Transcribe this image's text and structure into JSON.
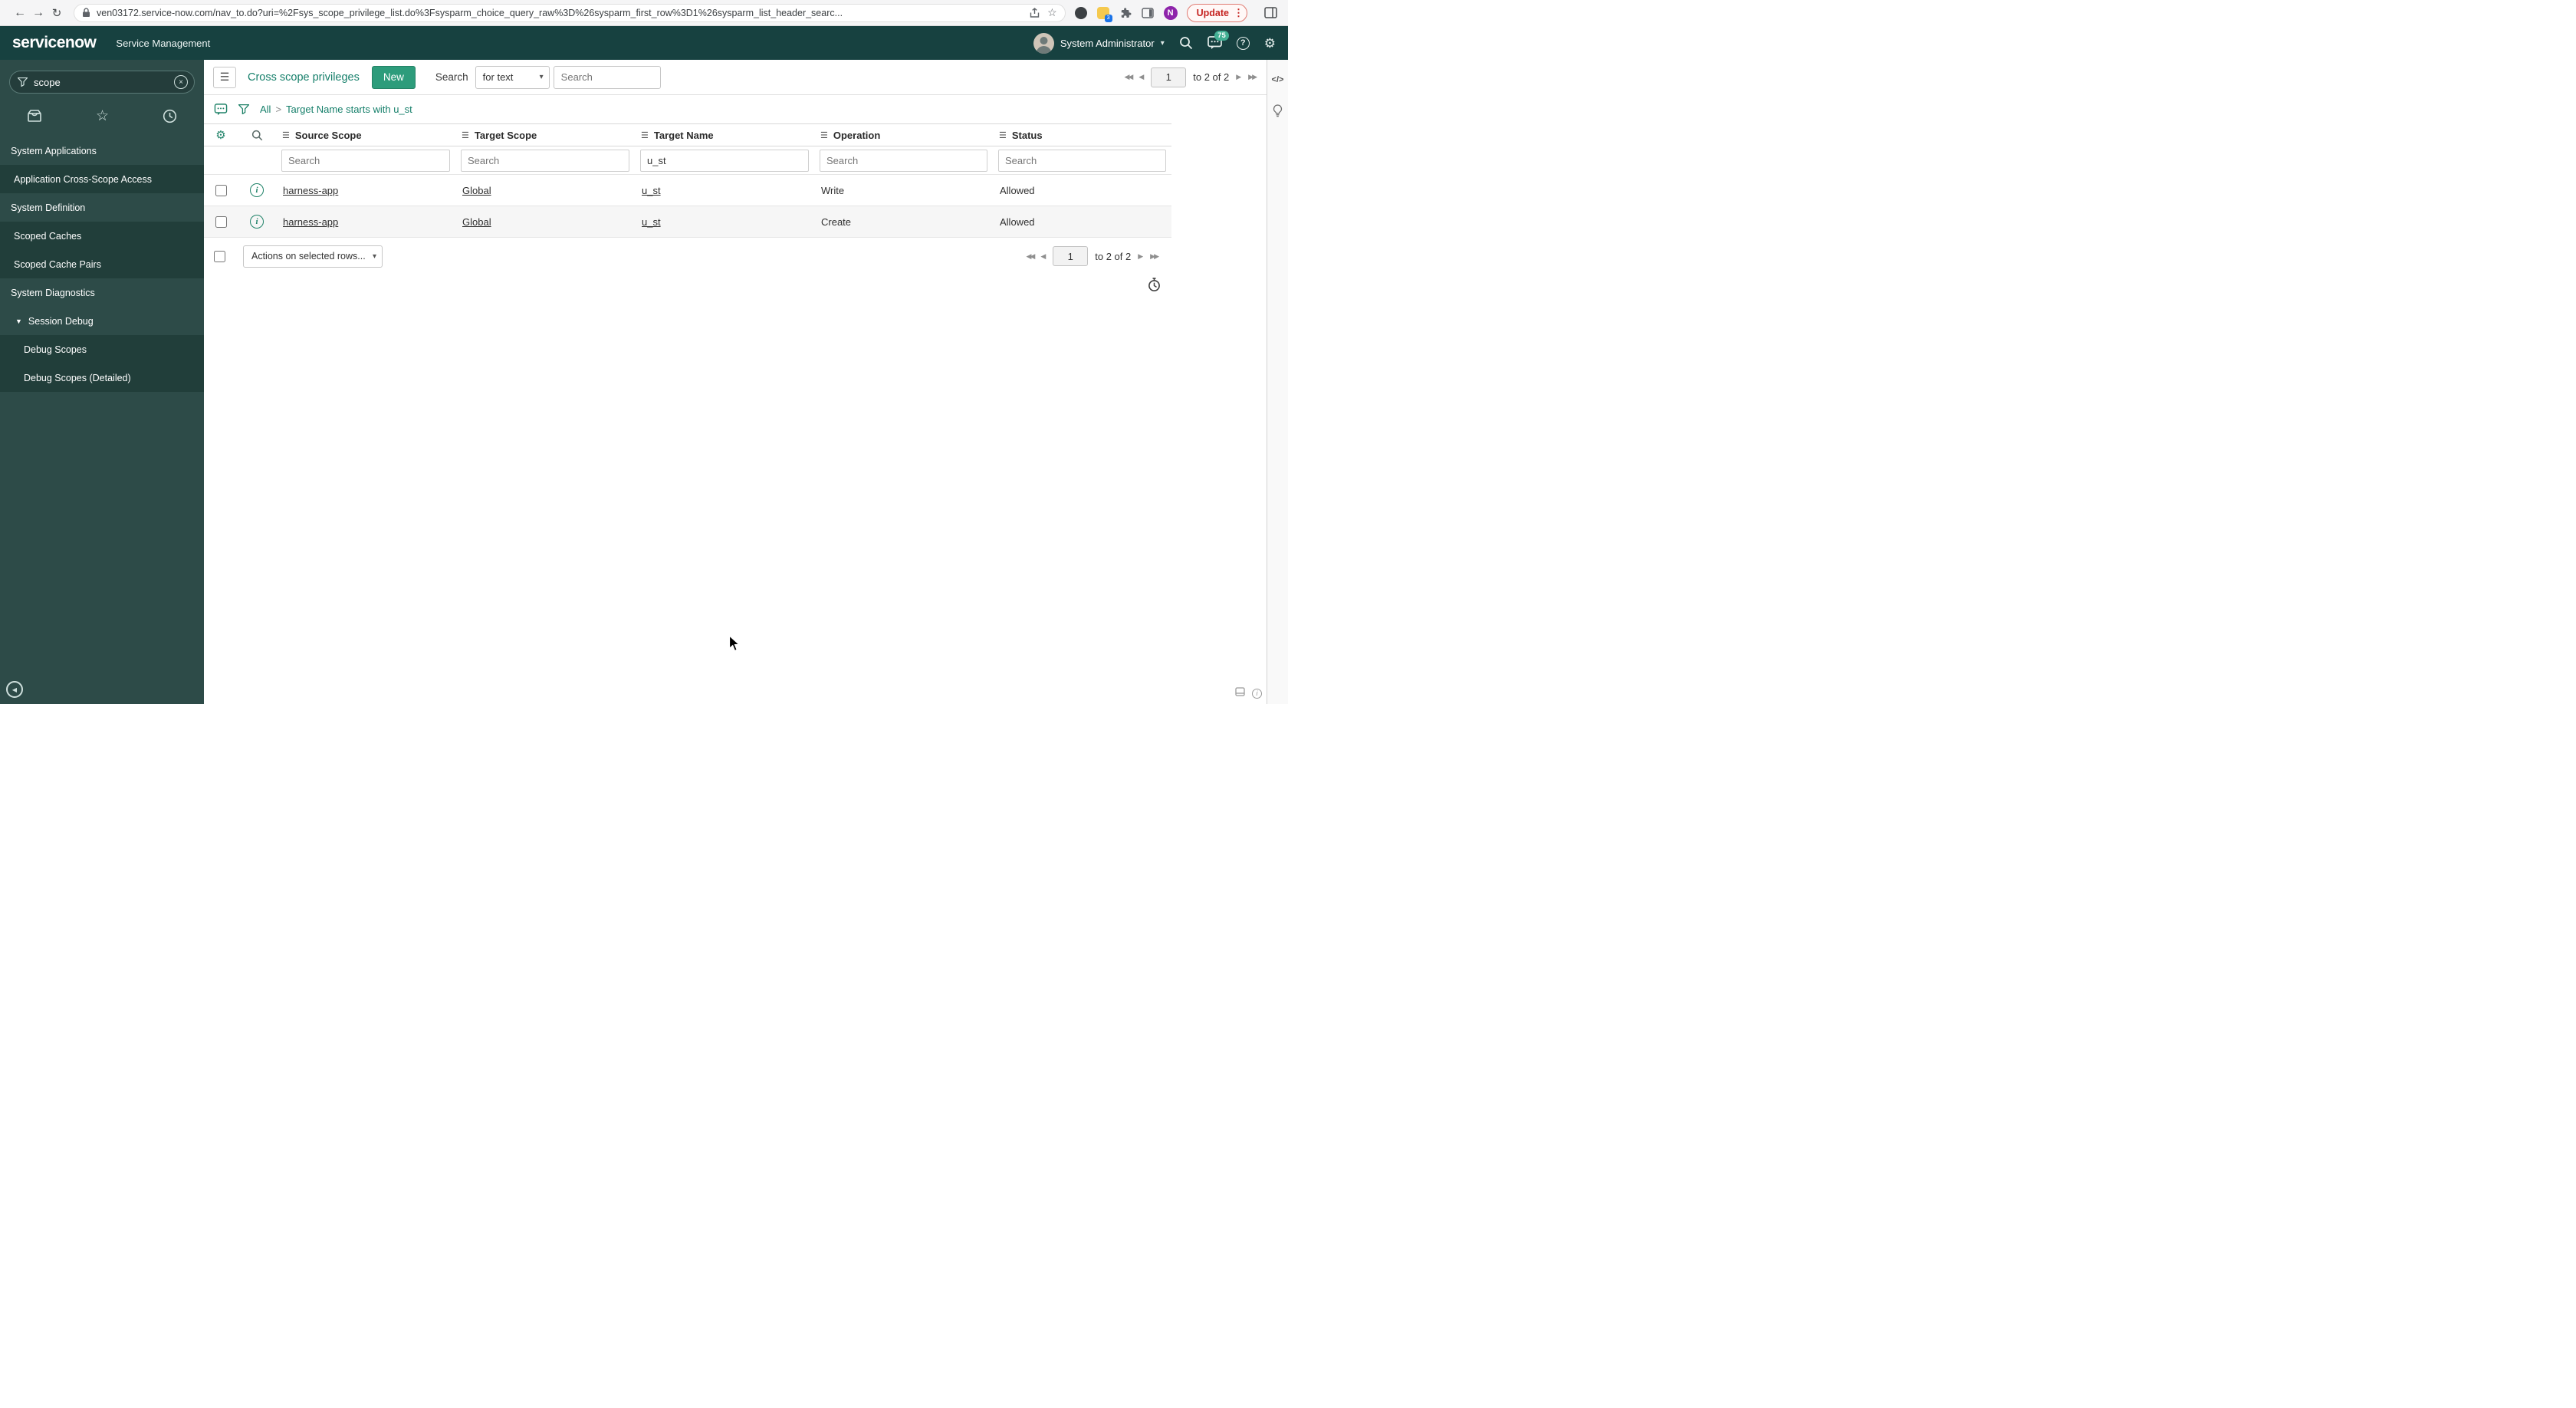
{
  "browser": {
    "url": "ven03172.service-now.com/nav_to.do?uri=%2Fsys_scope_privilege_list.do%3Fsysparm_choice_query_raw%3D%26sysparm_first_row%3D1%26sysparm_list_header_searc...",
    "update_label": "Update",
    "extension_badge": "3",
    "profile_initial": "N"
  },
  "banner": {
    "logo": "servicenow",
    "product": "Service Management",
    "user": "System Administrator",
    "notification_count": "75"
  },
  "sidebar": {
    "filter_value": "scope",
    "items": [
      {
        "label": "System Applications",
        "type": "section"
      },
      {
        "label": "Application Cross-Scope Access",
        "type": "child"
      },
      {
        "label": "System Definition",
        "type": "section"
      },
      {
        "label": "Scoped Caches",
        "type": "child"
      },
      {
        "label": "Scoped Cache Pairs",
        "type": "child"
      },
      {
        "label": "System Diagnostics",
        "type": "section"
      },
      {
        "label": "Session Debug",
        "type": "expanded"
      },
      {
        "label": "Debug Scopes",
        "type": "subchild"
      },
      {
        "label": "Debug Scopes (Detailed)",
        "type": "subchild"
      }
    ]
  },
  "list": {
    "title": "Cross scope privileges",
    "new_label": "New",
    "search_label": "Search",
    "search_type": "for text",
    "search_placeholder": "Search",
    "breadcrumb": {
      "all": "All",
      "sep": ">",
      "query": "Target Name starts with u_st"
    },
    "pagination": {
      "page": "1",
      "range": "to 2 of 2"
    },
    "columns": [
      "Source Scope",
      "Target Scope",
      "Target Name",
      "Operation",
      "Status"
    ],
    "filter_target_name": "u_st",
    "rows": [
      {
        "source_scope": "harness-app",
        "target_scope": "Global",
        "target_name": "u_st",
        "operation": "Write",
        "status": "Allowed"
      },
      {
        "source_scope": "harness-app",
        "target_scope": "Global",
        "target_name": "u_st",
        "operation": "Create",
        "status": "Allowed"
      }
    ],
    "actions_label": "Actions on selected rows..."
  },
  "icons": {
    "hamburger": "☰",
    "gear": "⚙",
    "caret_down": "▾",
    "tree_expanded": "▼",
    "back_arrow": "←",
    "forward_arrow": "→",
    "reload": "↻",
    "bookmark_star": "☆",
    "overflow_dots": "⋮",
    "code": "</>",
    "info": "i",
    "collapse_back": "◀",
    "chev_left": "◀",
    "chev_right": "▶",
    "chev_left_double": "◀◀",
    "chev_right_double": "▶▶",
    "clear_x": "×"
  },
  "colors": {
    "banner_bg": "#174140",
    "sidebar_bg": "#2d4b48",
    "teal_accent": "#157f6a",
    "new_button_bg": "#2d9c7b",
    "update_red": "#c5221f",
    "badge_teal": "#43b094"
  }
}
